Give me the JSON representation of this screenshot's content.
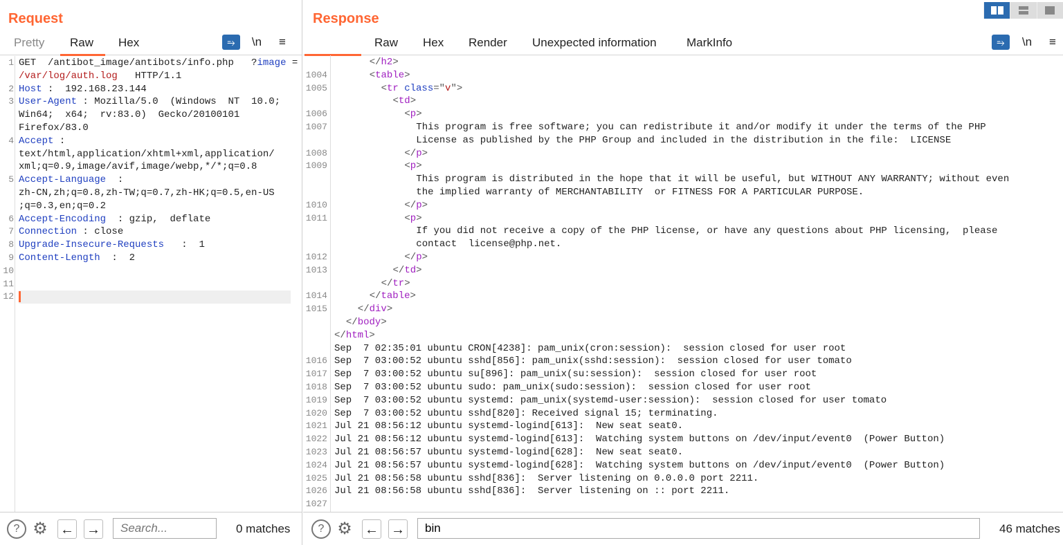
{
  "colors": {
    "accent": "#ff6633",
    "button_blue": "#2b6bb0",
    "key": "#1f3fc0",
    "value": "#b31b1b",
    "tag": "#a020c0"
  },
  "layout_toggle": {
    "icons": [
      "split-columns-icon",
      "split-rows-icon",
      "single-pane-icon"
    ],
    "selected": 0
  },
  "request": {
    "title": "Request",
    "tabs": [
      {
        "label": "Pretty"
      },
      {
        "label": "Raw"
      },
      {
        "label": "Hex"
      }
    ],
    "active_tab": "Raw",
    "icons": {
      "wrap": "word-wrap-icon",
      "newline": "\\n",
      "menu": "≡"
    },
    "rows": [
      {
        "n": "1",
        "segs": [
          [
            "GET  /antibot_image/antibots/info.php   ?",
            ""
          ],
          [
            "image",
            "k"
          ],
          [
            " =",
            ""
          ]
        ]
      },
      {
        "n": "",
        "segs": [
          [
            "/var/log/auth.log",
            "v"
          ],
          [
            "   HTTP/1.1",
            ""
          ]
        ]
      },
      {
        "n": "2",
        "segs": [
          [
            "Host",
            "k"
          ],
          [
            " :  192.168.23.144",
            ""
          ]
        ]
      },
      {
        "n": "3",
        "segs": [
          [
            "User-Agent",
            "k"
          ],
          [
            " : Mozilla/5.0  (Windows  NT  10.0;",
            ""
          ]
        ]
      },
      {
        "n": "",
        "segs": [
          [
            "Win64;  x64;  rv:83.0)  Gecko/20100101",
            ""
          ]
        ]
      },
      {
        "n": "",
        "segs": [
          [
            "Firefox/83.0",
            ""
          ]
        ]
      },
      {
        "n": "4",
        "segs": [
          [
            "Accept",
            "k"
          ],
          [
            " :",
            ""
          ]
        ]
      },
      {
        "n": "",
        "segs": [
          [
            "text/html,application/xhtml+xml,application/",
            ""
          ]
        ]
      },
      {
        "n": "",
        "segs": [
          [
            "xml;q=0.9,image/avif,image/webp,*/*;q=0.8",
            ""
          ]
        ]
      },
      {
        "n": "5",
        "segs": [
          [
            "Accept-Language",
            "k"
          ],
          [
            "  :",
            ""
          ]
        ]
      },
      {
        "n": "",
        "segs": [
          [
            "zh-CN,zh;q=0.8,zh-TW;q=0.7,zh-HK;q=0.5,en-US",
            ""
          ]
        ]
      },
      {
        "n": "",
        "segs": [
          [
            ";q=0.3,en;q=0.2",
            ""
          ]
        ]
      },
      {
        "n": "6",
        "segs": [
          [
            "Accept-Encoding",
            "k"
          ],
          [
            "  : gzip,  deflate",
            ""
          ]
        ]
      },
      {
        "n": "7",
        "segs": [
          [
            "Connection",
            "k"
          ],
          [
            " : close",
            ""
          ]
        ]
      },
      {
        "n": "8",
        "segs": [
          [
            "Upgrade-Insecure-Requests",
            "k"
          ],
          [
            "   :  1",
            ""
          ]
        ]
      },
      {
        "n": "9",
        "segs": [
          [
            "Content-Length",
            "k"
          ],
          [
            "  :  2",
            ""
          ]
        ]
      },
      {
        "n": "10",
        "segs": []
      },
      {
        "n": "11",
        "segs": []
      },
      {
        "n": "12",
        "segs": [],
        "current": true
      }
    ],
    "search": {
      "placeholder": "Search...",
      "value": "",
      "matches": "0 matches"
    }
  },
  "response": {
    "title": "Response",
    "tabs": [
      {
        "label": ""
      },
      {
        "label": "Raw"
      },
      {
        "label": "Hex"
      },
      {
        "label": "Render"
      },
      {
        "label": "Unexpected information"
      },
      {
        "label": "MarkInfo"
      }
    ],
    "icons": {
      "wrap": "word-wrap-icon",
      "newline": "\\n",
      "menu": "≡"
    },
    "rows": [
      {
        "n": "",
        "l": 3,
        "segs": [
          [
            "</",
            "p"
          ],
          [
            "h2",
            "tg"
          ],
          [
            ">",
            "p"
          ]
        ]
      },
      {
        "n": "1004",
        "l": 3,
        "segs": [
          [
            "<",
            "p"
          ],
          [
            "table",
            "tg"
          ],
          [
            ">",
            "p"
          ]
        ]
      },
      {
        "n": "1005",
        "l": 4,
        "segs": [
          [
            "<",
            "p"
          ],
          [
            "tr",
            "tg"
          ],
          [
            " class",
            "k"
          ],
          [
            "=\"",
            "p"
          ],
          [
            "v",
            "v"
          ],
          [
            "\">",
            "p"
          ]
        ]
      },
      {
        "n": "",
        "l": 5,
        "segs": [
          [
            "<",
            "p"
          ],
          [
            "td",
            "tg"
          ],
          [
            ">",
            "p"
          ]
        ]
      },
      {
        "n": "1006",
        "l": 6,
        "segs": [
          [
            "<",
            "p"
          ],
          [
            "p",
            "tg"
          ],
          [
            ">",
            "p"
          ]
        ]
      },
      {
        "n": "1007",
        "l": 7,
        "segs": [
          [
            "This program is free software; you can redistribute it and/or modify it under the terms of the PHP",
            ""
          ]
        ]
      },
      {
        "n": "",
        "l": 7,
        "segs": [
          [
            "License as published by the PHP Group and included in the distribution in the file:  LICENSE",
            ""
          ]
        ]
      },
      {
        "n": "1008",
        "l": 6,
        "segs": [
          [
            "</",
            "p"
          ],
          [
            "p",
            "tg"
          ],
          [
            ">",
            "p"
          ]
        ]
      },
      {
        "n": "1009",
        "l": 6,
        "segs": [
          [
            "<",
            "p"
          ],
          [
            "p",
            "tg"
          ],
          [
            ">",
            "p"
          ]
        ]
      },
      {
        "n": "",
        "l": 7,
        "segs": [
          [
            "This program is distributed in the hope that it will be useful, but WITHOUT ANY WARRANTY; without even",
            ""
          ]
        ]
      },
      {
        "n": "",
        "l": 7,
        "segs": [
          [
            "the implied warranty of MERCHANTABILITY  or FITNESS FOR A PARTICULAR PURPOSE.",
            ""
          ]
        ]
      },
      {
        "n": "1010",
        "l": 6,
        "segs": [
          [
            "</",
            "p"
          ],
          [
            "p",
            "tg"
          ],
          [
            ">",
            "p"
          ]
        ]
      },
      {
        "n": "1011",
        "l": 6,
        "segs": [
          [
            "<",
            "p"
          ],
          [
            "p",
            "tg"
          ],
          [
            ">",
            "p"
          ]
        ]
      },
      {
        "n": "",
        "l": 7,
        "segs": [
          [
            "If you did not receive a copy of the PHP license, or have any questions about PHP licensing,  please",
            ""
          ]
        ]
      },
      {
        "n": "",
        "l": 7,
        "segs": [
          [
            "contact  license@php.net.",
            ""
          ]
        ]
      },
      {
        "n": "1012",
        "l": 6,
        "segs": [
          [
            "</",
            "p"
          ],
          [
            "p",
            "tg"
          ],
          [
            ">",
            "p"
          ]
        ]
      },
      {
        "n": "1013",
        "l": 5,
        "segs": [
          [
            "</",
            "p"
          ],
          [
            "td",
            "tg"
          ],
          [
            ">",
            "p"
          ]
        ]
      },
      {
        "n": "",
        "l": 4,
        "segs": [
          [
            "</",
            "p"
          ],
          [
            "tr",
            "tg"
          ],
          [
            ">",
            "p"
          ]
        ]
      },
      {
        "n": "1014",
        "l": 3,
        "segs": [
          [
            "</",
            "p"
          ],
          [
            "table",
            "tg"
          ],
          [
            ">",
            "p"
          ]
        ]
      },
      {
        "n": "1015",
        "l": 2,
        "segs": [
          [
            "</",
            "p"
          ],
          [
            "div",
            "tg"
          ],
          [
            ">",
            "p"
          ]
        ]
      },
      {
        "n": "",
        "l": 1,
        "segs": [
          [
            "</",
            "p"
          ],
          [
            "body",
            "tg"
          ],
          [
            ">",
            "p"
          ]
        ]
      },
      {
        "n": "",
        "l": 0,
        "segs": [
          [
            "</",
            "p"
          ],
          [
            "html",
            "tg"
          ],
          [
            ">",
            "p"
          ]
        ]
      },
      {
        "n": "",
        "l": 0,
        "segs": [
          [
            "Sep  7 02:35:01 ubuntu CRON[4238]: pam_unix(cron:session):  session closed for user root",
            ""
          ]
        ]
      },
      {
        "n": "1016",
        "l": 0,
        "segs": [
          [
            "Sep  7 03:00:52 ubuntu sshd[856]: pam_unix(sshd:session):  session closed for user tomato",
            ""
          ]
        ]
      },
      {
        "n": "1017",
        "l": 0,
        "segs": [
          [
            "Sep  7 03:00:52 ubuntu su[896]: pam_unix(su:session):  session closed for user root",
            ""
          ]
        ]
      },
      {
        "n": "1018",
        "l": 0,
        "segs": [
          [
            "Sep  7 03:00:52 ubuntu sudo: pam_unix(sudo:session):  session closed for user root",
            ""
          ]
        ]
      },
      {
        "n": "1019",
        "l": 0,
        "segs": [
          [
            "Sep  7 03:00:52 ubuntu systemd: pam_unix(systemd-user:session):  session closed for user tomato",
            ""
          ]
        ]
      },
      {
        "n": "1020",
        "l": 0,
        "segs": [
          [
            "Sep  7 03:00:52 ubuntu sshd[820]: Received signal 15; terminating.",
            ""
          ]
        ]
      },
      {
        "n": "1021",
        "l": 0,
        "segs": [
          [
            "Jul 21 08:56:12 ubuntu systemd-logind[613]:  New seat seat0.",
            ""
          ]
        ]
      },
      {
        "n": "1022",
        "l": 0,
        "segs": [
          [
            "Jul 21 08:56:12 ubuntu systemd-logind[613]:  Watching system buttons on /dev/input/event0  (Power Button)",
            ""
          ]
        ]
      },
      {
        "n": "1023",
        "l": 0,
        "segs": [
          [
            "Jul 21 08:56:57 ubuntu systemd-logind[628]:  New seat seat0.",
            ""
          ]
        ]
      },
      {
        "n": "1024",
        "l": 0,
        "segs": [
          [
            "Jul 21 08:56:57 ubuntu systemd-logind[628]:  Watching system buttons on /dev/input/event0  (Power Button)",
            ""
          ]
        ]
      },
      {
        "n": "1025",
        "l": 0,
        "segs": [
          [
            "Jul 21 08:56:58 ubuntu sshd[836]:  Server listening on 0.0.0.0 port 2211.",
            ""
          ]
        ]
      },
      {
        "n": "1026",
        "l": 0,
        "segs": [
          [
            "Jul 21 08:56:58 ubuntu sshd[836]:  Server listening on :: port 2211.",
            ""
          ]
        ]
      },
      {
        "n": "1027",
        "l": 0,
        "segs": []
      }
    ],
    "search": {
      "placeholder": "Search...",
      "value": "bin",
      "matches": "46 matches"
    }
  }
}
